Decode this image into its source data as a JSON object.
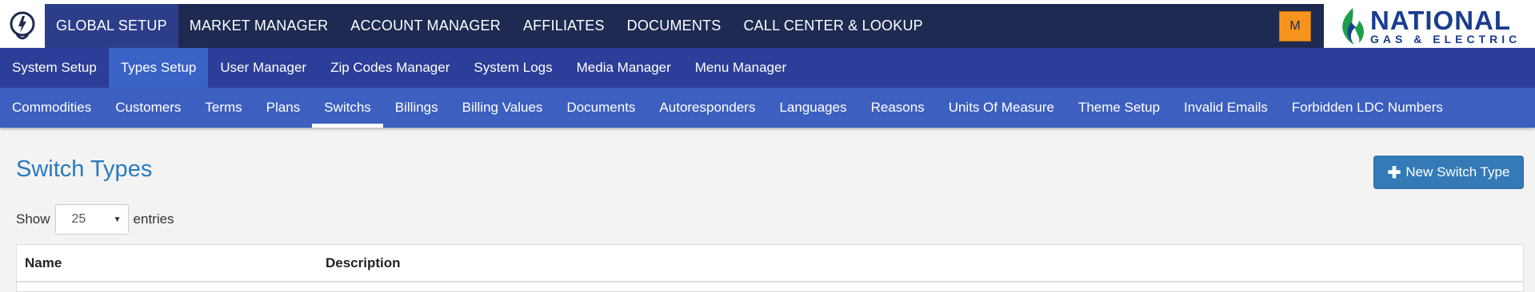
{
  "top_nav": {
    "items": [
      {
        "label": "GLOBAL SETUP",
        "active": true
      },
      {
        "label": "MARKET MANAGER",
        "active": false
      },
      {
        "label": "ACCOUNT MANAGER",
        "active": false
      },
      {
        "label": "AFFILIATES",
        "active": false
      },
      {
        "label": "DOCUMENTS",
        "active": false
      },
      {
        "label": "CALL CENTER & LOOKUP",
        "active": false
      }
    ],
    "user_badge": "M",
    "brand": {
      "line1": "NATIONAL",
      "line2": "GAS & ELECTRIC"
    }
  },
  "sub_nav": {
    "items": [
      {
        "label": "System Setup",
        "active": false
      },
      {
        "label": "Types Setup",
        "active": true
      },
      {
        "label": "User Manager",
        "active": false
      },
      {
        "label": "Zip Codes Manager",
        "active": false
      },
      {
        "label": "System Logs",
        "active": false
      },
      {
        "label": "Media Manager",
        "active": false
      },
      {
        "label": "Menu Manager",
        "active": false
      }
    ]
  },
  "types_nav": {
    "items": [
      {
        "label": "Commodities",
        "active": false
      },
      {
        "label": "Customers",
        "active": false
      },
      {
        "label": "Terms",
        "active": false
      },
      {
        "label": "Plans",
        "active": false
      },
      {
        "label": "Switchs",
        "active": true
      },
      {
        "label": "Billings",
        "active": false
      },
      {
        "label": "Billing Values",
        "active": false
      },
      {
        "label": "Documents",
        "active": false
      },
      {
        "label": "Autoresponders",
        "active": false
      },
      {
        "label": "Languages",
        "active": false
      },
      {
        "label": "Reasons",
        "active": false
      },
      {
        "label": "Units Of Measure",
        "active": false
      },
      {
        "label": "Theme Setup",
        "active": false
      },
      {
        "label": "Invalid Emails",
        "active": false
      },
      {
        "label": "Forbidden LDC Numbers",
        "active": false
      }
    ]
  },
  "main": {
    "title": "Switch Types",
    "new_button_label": "New Switch Type",
    "show_label": "Show",
    "page_size": "25",
    "entries_label": "entries",
    "table": {
      "columns": [
        "Name",
        "Description"
      ]
    }
  },
  "colors": {
    "top_nav_bg": "#1f2a52",
    "sub_nav_bg": "#2c3e99",
    "types_nav_bg": "#3d5fc0",
    "title": "#2a7abf",
    "button": "#337ab7",
    "user_badge": "#f7941d"
  }
}
